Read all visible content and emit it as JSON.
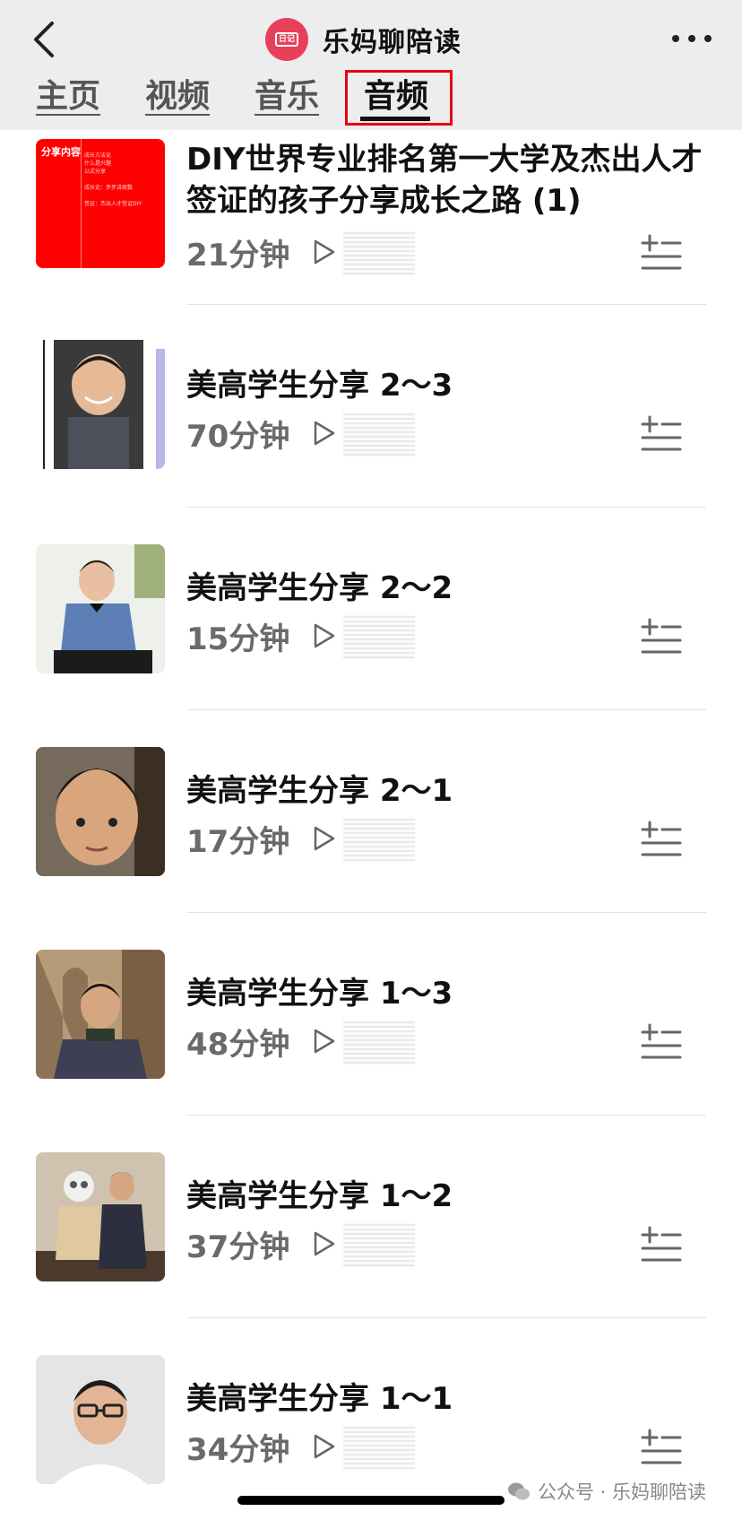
{
  "header": {
    "account_name": "乐妈聊陪读",
    "avatar_text": "日记"
  },
  "tabs": [
    {
      "label": "主页",
      "active": false
    },
    {
      "label": "视频",
      "active": false
    },
    {
      "label": "音乐",
      "active": false
    },
    {
      "label": "音频",
      "active": true
    }
  ],
  "items": [
    {
      "title": "DIY世界专业排名第一大学及杰出人才签证的孩子分享成长之路 (1)",
      "duration": "21分钟",
      "thumb": "slide",
      "thumb_text": "分享内容",
      "thumb_sub": "成长方法论\n什么是兴趣\n公式分享\n\n成长史：步步讲原数\n\n签证：杰出人才签证DIY"
    },
    {
      "title": "美高学生分享 2～3",
      "duration": "70分钟",
      "thumb": "photo-boy-1"
    },
    {
      "title": "美高学生分享 2～2",
      "duration": "15分钟",
      "thumb": "photo-boy-2"
    },
    {
      "title": "美高学生分享 2～1",
      "duration": "17分钟",
      "thumb": "photo-boy-3"
    },
    {
      "title": "美高学生分享 1～3",
      "duration": "48分钟",
      "thumb": "photo-boy-4"
    },
    {
      "title": "美高学生分享 1～2",
      "duration": "37分钟",
      "thumb": "photo-boy-5"
    },
    {
      "title": "美高学生分享 1～1",
      "duration": "34分钟",
      "thumb": "photo-boy-6"
    }
  ],
  "watermark": "公众号 · 乐妈聊陪读",
  "colors": {
    "accent_red": "#e60012",
    "avatar_pink": "#e8405a",
    "topbar_bg": "#ededed"
  }
}
